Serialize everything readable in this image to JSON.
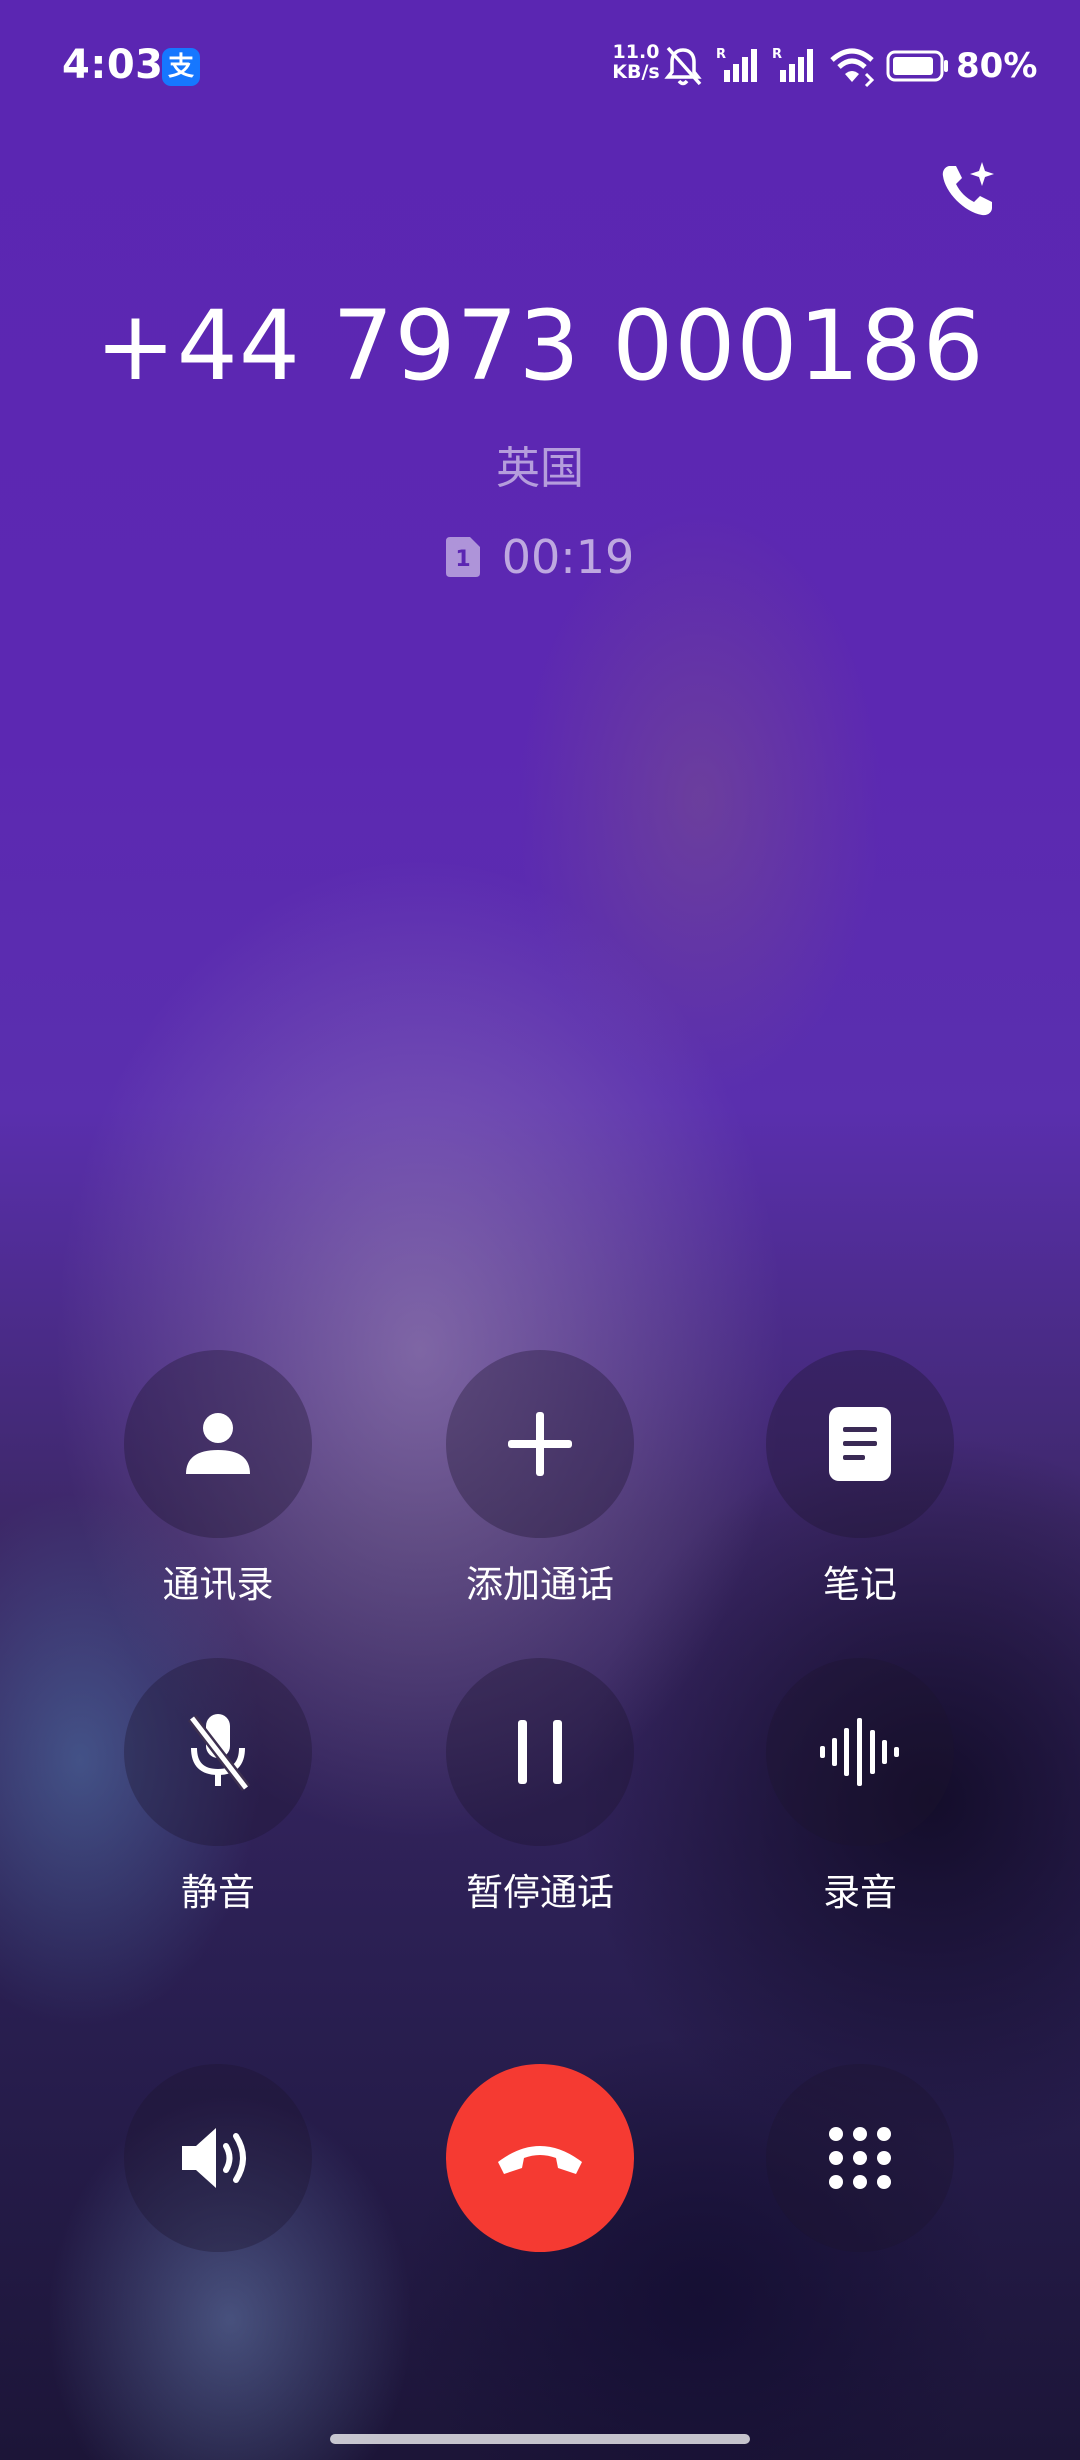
{
  "status_bar": {
    "time": "4:03",
    "app_badge": "支",
    "net_speed_value": "11.0",
    "net_speed_unit": "KB/s",
    "signal1_tag": "R",
    "signal2_tag": "R",
    "battery": "80%"
  },
  "call": {
    "number": "+44 7973 000186",
    "location": "英国",
    "sim_slot": "1",
    "duration": "00:19"
  },
  "controls": {
    "contacts": "通讯录",
    "add_call": "添加通话",
    "notes": "笔记",
    "mute": "静音",
    "hold": "暂停通话",
    "record": "录音"
  },
  "colors": {
    "accent_bg": "#5b26b2",
    "end_call": "#f53a32",
    "alipay": "#1677ff"
  }
}
